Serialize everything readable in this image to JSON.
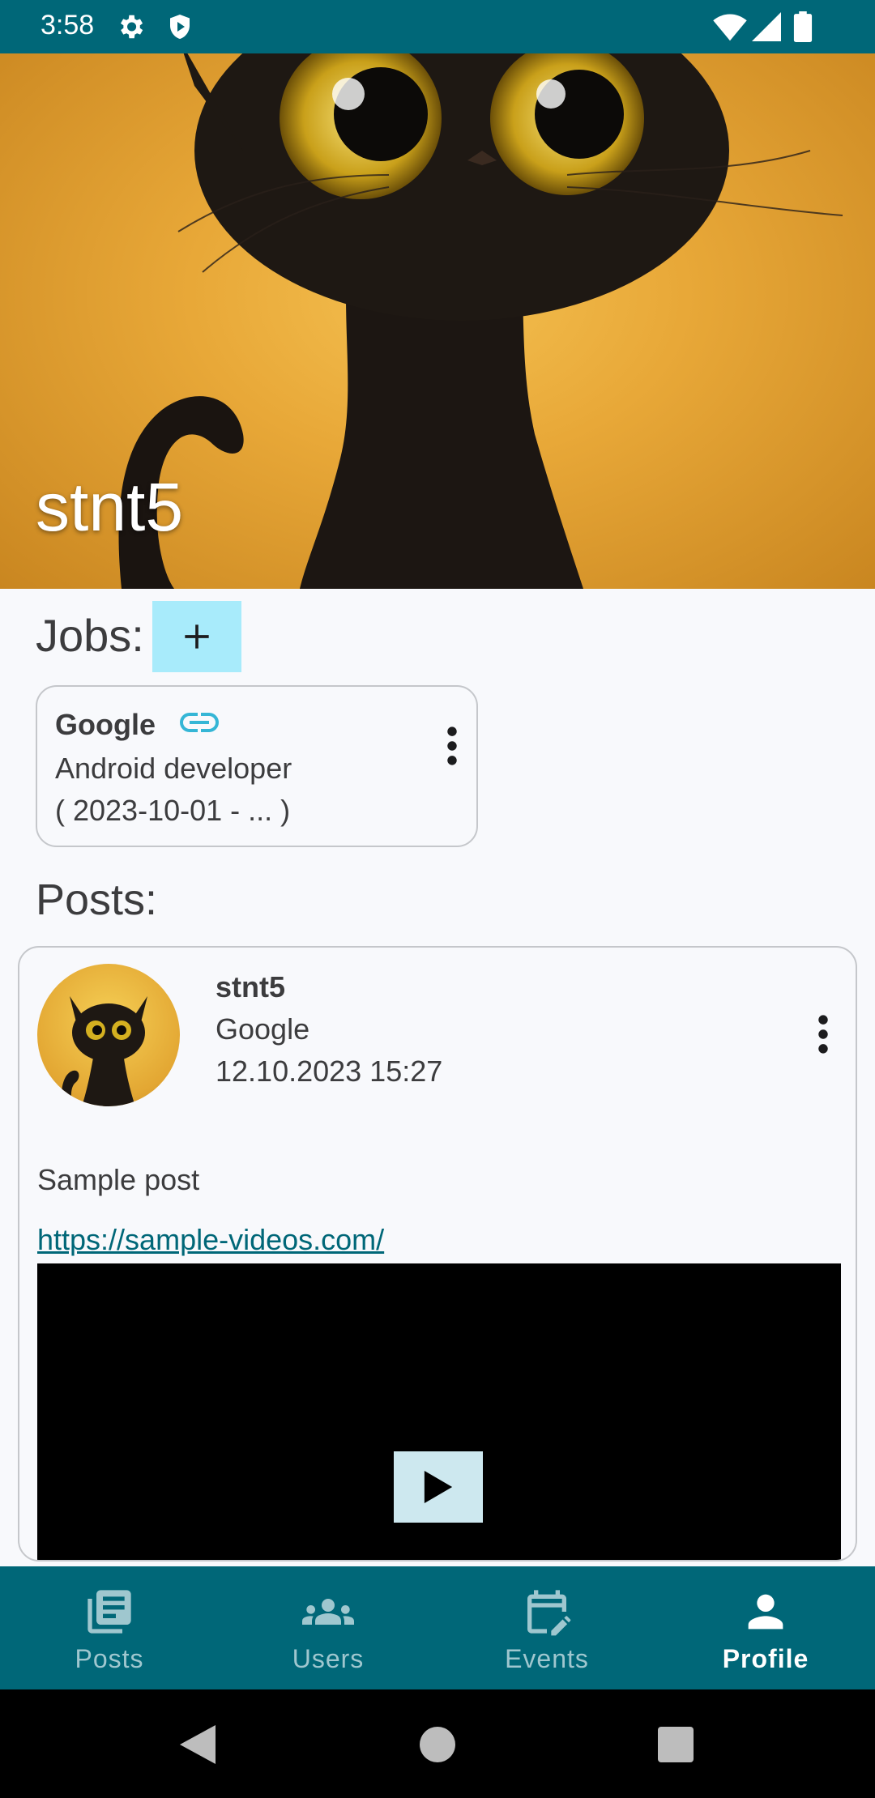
{
  "status_bar": {
    "time": "3:58",
    "icons": [
      "gear-icon",
      "shield-play-icon",
      "wifi-icon",
      "signal-icon",
      "battery-icon"
    ]
  },
  "profile": {
    "name": "stnt5"
  },
  "jobs": {
    "title": "Jobs:",
    "add_icon": "plus-icon",
    "items": [
      {
        "company": "Google",
        "position": "Android developer",
        "period": "( 2023-10-01 - ... )"
      }
    ]
  },
  "posts": {
    "title": "Posts:",
    "items": [
      {
        "author": "stnt5",
        "job": "Google",
        "date": "12.10.2023 15:27",
        "text": "Sample post",
        "link": "https://sample-videos.com/"
      }
    ]
  },
  "bottom_nav": {
    "items": [
      {
        "label": "Posts",
        "icon": "posts-icon",
        "active": false
      },
      {
        "label": "Users",
        "icon": "users-icon",
        "active": false
      },
      {
        "label": "Events",
        "icon": "events-icon",
        "active": false
      },
      {
        "label": "Profile",
        "icon": "profile-icon",
        "active": true
      }
    ]
  },
  "colors": {
    "primary": "#006778",
    "accent": "#a8ebfb",
    "background": "#f8f9fc"
  }
}
